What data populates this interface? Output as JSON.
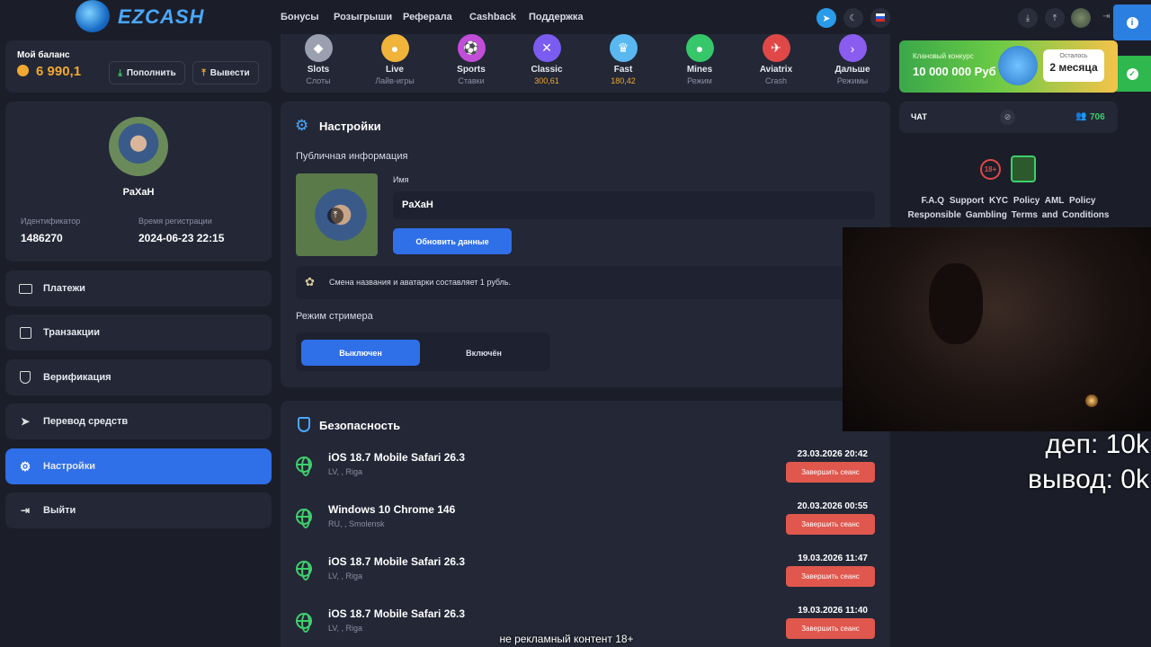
{
  "header": {
    "logo_text": "EZCASH",
    "nav": [
      "Бонусы",
      "Розыгрыши",
      "Реферала",
      "Cashback",
      "Поддержка"
    ]
  },
  "balance": {
    "label": "Мой баланс",
    "amount": "6 990,1",
    "deposit": "Пополнить",
    "withdraw": "Вывести"
  },
  "games": [
    {
      "name": "Slots",
      "sub": "Слоты",
      "color": "#9aa0b0",
      "icon": "slots-icon",
      "glyph": "◆"
    },
    {
      "name": "Live",
      "sub": "Лайв-игры",
      "color": "#f0b43a",
      "icon": "live-icon",
      "glyph": "●"
    },
    {
      "name": "Sports",
      "sub": "Ставки",
      "color": "#c24dd8",
      "icon": "sports-icon",
      "glyph": "⚽"
    },
    {
      "name": "Classic",
      "sub": "300,61",
      "color": "#7b5cf0",
      "icon": "classic-icon",
      "glyph": "✕"
    },
    {
      "name": "Fast",
      "sub": "180,42",
      "color": "#5ab8f0",
      "icon": "fast-icon",
      "glyph": "♛"
    },
    {
      "name": "Mines",
      "sub": "Режим",
      "color": "#35c76a",
      "icon": "mines-icon",
      "glyph": "●"
    },
    {
      "name": "Aviatrix",
      "sub": "Crash",
      "color": "#e04848",
      "icon": "aviatrix-icon",
      "glyph": "✈"
    },
    {
      "name": "Дальше",
      "sub": "Режимы",
      "color": "#8a5cf0",
      "icon": "chevron-right-icon",
      "glyph": "›"
    }
  ],
  "promo": {
    "title": "Клановый конкурс",
    "amount": "10 000 000 Руб",
    "left_label": "Осталось",
    "left_value": "2 месяца"
  },
  "profile": {
    "username": "PaXaH",
    "id_label": "Идентификатор",
    "id_value": "1486270",
    "reg_label": "Время регистрации",
    "reg_value": "2024-06-23 22:15"
  },
  "menu": [
    "Платежи",
    "Транзакции",
    "Верификация",
    "Перевод средств",
    "Настройки",
    "Выйти"
  ],
  "settings": {
    "title": "Настройки",
    "public_info": "Публичная информация",
    "name_label": "Имя",
    "name_value": "PaXaH",
    "update_button": "Обновить данные",
    "notice": "Смена названия и аватарки составляет 1 рубль.",
    "streamer_label": "Режим стримера",
    "off": "Выключен",
    "on": "Включён"
  },
  "security": {
    "title": "Безопасность",
    "end_label": "Завершить сеанс",
    "sessions": [
      {
        "device": "iOS 18.7 Mobile Safari 26.3",
        "loc": "LV, , Riga",
        "date": "23.03.2026 20:42"
      },
      {
        "device": "Windows 10 Chrome 146",
        "loc": "RU, , Smolensk",
        "date": "20.03.2026 00:55"
      },
      {
        "device": "iOS 18.7 Mobile Safari 26.3",
        "loc": "LV, , Riga",
        "date": "19.03.2026 11:47"
      },
      {
        "device": "iOS 18.7 Mobile Safari 26.3",
        "loc": "LV, , Riga",
        "date": "19.03.2026 11:40"
      }
    ]
  },
  "chat": {
    "label": "ЧАТ",
    "online": "706",
    "age_badge": "18+",
    "links_row1": [
      "F.A.Q",
      "Support",
      "KYC Policy",
      "AML Policy"
    ],
    "links_row2": [
      "Responsible Gambling",
      "Terms and Conditions"
    ]
  },
  "overlay": {
    "deposit": "деп: 10k",
    "withdraw": "вывод: 0k",
    "caption": "не рекламный контент 18+"
  }
}
